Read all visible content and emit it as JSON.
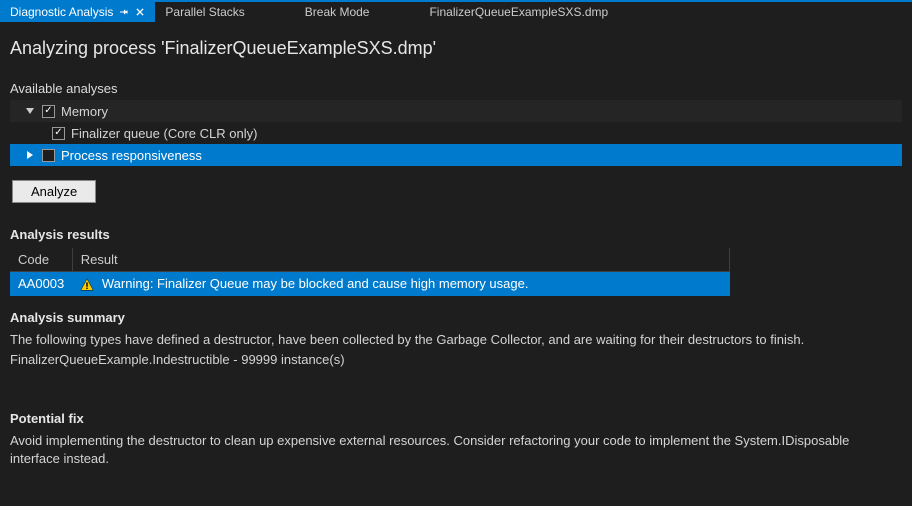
{
  "tabs": [
    {
      "label": "Diagnostic Analysis",
      "active": true,
      "pinned": true
    },
    {
      "label": "Parallel Stacks",
      "active": false
    },
    {
      "label": "Break Mode",
      "active": false
    },
    {
      "label": "FinalizerQueueExampleSXS.dmp",
      "active": false
    }
  ],
  "heading": "Analyzing process 'FinalizerQueueExampleSXS.dmp'",
  "available_analyses_label": "Available analyses",
  "tree": {
    "memory": {
      "label": "Memory",
      "checked": true,
      "expanded": true
    },
    "finalizer": {
      "label": "Finalizer queue (Core CLR only)",
      "checked": true
    },
    "responsiveness": {
      "label": "Process responsiveness",
      "checked": false,
      "expanded": false,
      "selected": true
    }
  },
  "analyze_button": "Analyze",
  "analysis_results_label": "Analysis results",
  "results_columns": {
    "code": "Code",
    "result": "Result"
  },
  "results_rows": [
    {
      "code": "AA0003",
      "result": "Warning: Finalizer Queue may be blocked and cause high memory usage.",
      "icon": "warning"
    }
  ],
  "analysis_summary_label": "Analysis summary",
  "summary_text_1": "The following types have defined a destructor, have been collected by the Garbage Collector, and are waiting for their destructors to finish.",
  "summary_text_2": "FinalizerQueueExample.Indestructible - 99999 instance(s)",
  "potential_fix_label": "Potential fix",
  "potential_fix_text": "Avoid implementing the destructor to clean up expensive external resources. Consider refactoring your code to implement the System.IDisposable interface instead."
}
